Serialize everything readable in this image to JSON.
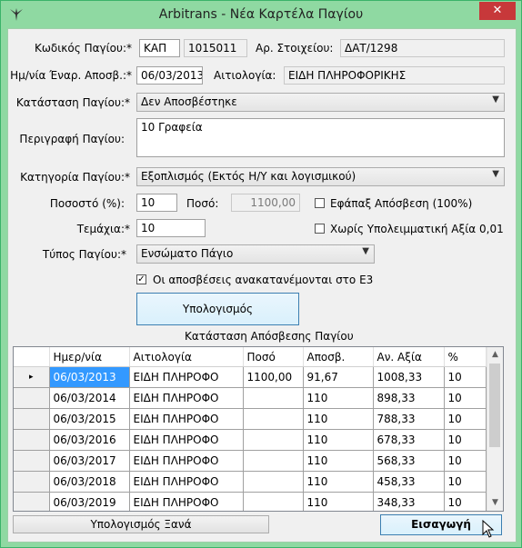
{
  "window": {
    "title": "Arbitrans - Νέα Καρτέλα Παγίου",
    "close": "✕"
  },
  "colors": {
    "frame": "#8fd9a2",
    "close": "#c7383a",
    "selection": "#3399ff"
  },
  "form": {
    "code_label": "Κωδικός Παγίου:*",
    "code_prefix": "ΚΑΠ",
    "code_number": "1015011",
    "item_no_label": "Αρ. Στοιχείου:",
    "item_no": "ΔΑΤ/1298",
    "start_date_label": "Ημ/νία Έναρ. Αποσβ.:*",
    "start_date": "06/03/2013",
    "reason_label": "Αιτιολογία:",
    "reason": "ΕΙΔΗ ΠΛΗΡΟΦΟΡΙΚΗΣ",
    "status_label": "Κατάσταση Παγίου:*",
    "status": "Δεν Αποσβέστηκε",
    "description_label": "Περιγραφή Παγίου:",
    "description": "10 Γραφεία",
    "category_label": "Κατηγορία Παγίου:*",
    "category": "Εξοπλισμός (Εκτός Η/Υ και λογισμικού)",
    "percent_label": "Ποσοστό (%):",
    "percent": "10",
    "amount_label": "Ποσό:",
    "amount": "1100,00",
    "onetime_label": "Εφάπαξ Απόσβεση (100%)",
    "onetime_checked": false,
    "pieces_label": "Τεμάχια:*",
    "pieces": "10",
    "noresidual_label": "Χωρίς Υπολειμματική Αξία 0,01",
    "noresidual_checked": false,
    "type_label": "Τύπος Παγίου:*",
    "type": "Ενσώματο Πάγιο",
    "e3_label": "Οι αποσβέσεις ανακατανέμονται στο Ε3",
    "e3_checked": true,
    "calc_button": "Υπολογισμός"
  },
  "table": {
    "caption": "Κατάσταση Απόσβεσης Παγίου",
    "columns": [
      "Ημερ/νία",
      "Αιτιολογία",
      "Ποσό",
      "Αποσβ.",
      "Αν. Αξία",
      "%"
    ],
    "rows": [
      [
        "06/03/2013",
        "ΕΙΔΗ ΠΛΗΡΟΦΟ",
        "1100,00",
        "91,67",
        "1008,33",
        "10"
      ],
      [
        "06/03/2014",
        "ΕΙΔΗ ΠΛΗΡΟΦΟ",
        "",
        "110",
        "898,33",
        "10"
      ],
      [
        "06/03/2015",
        "ΕΙΔΗ ΠΛΗΡΟΦΟ",
        "",
        "110",
        "788,33",
        "10"
      ],
      [
        "06/03/2016",
        "ΕΙΔΗ ΠΛΗΡΟΦΟ",
        "",
        "110",
        "678,33",
        "10"
      ],
      [
        "06/03/2017",
        "ΕΙΔΗ ΠΛΗΡΟΦΟ",
        "",
        "110",
        "568,33",
        "10"
      ],
      [
        "06/03/2018",
        "ΕΙΔΗ ΠΛΗΡΟΦΟ",
        "",
        "110",
        "458,33",
        "10"
      ],
      [
        "06/03/2019",
        "ΕΙΔΗ ΠΛΗΡΟΦΟ",
        "",
        "110",
        "348,33",
        "10"
      ]
    ],
    "current_row_marker": "▸"
  },
  "footer": {
    "recalc_button": "Υπολογισμός Ξανά",
    "insert_button": "Εισαγωγή"
  }
}
